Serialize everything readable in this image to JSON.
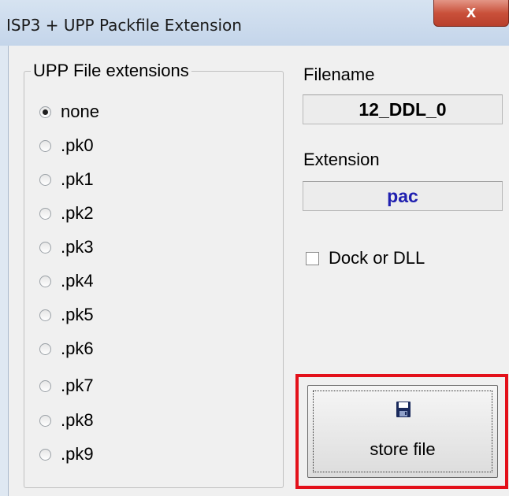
{
  "window": {
    "title": "ISP3 + UPP Packfile Extension",
    "close_label": "x"
  },
  "group": {
    "legend": "UPP File extensions",
    "options": [
      {
        "label": "none",
        "checked": true
      },
      {
        "label": ".pk0",
        "checked": false
      },
      {
        "label": ".pk1",
        "checked": false
      },
      {
        "label": ".pk2",
        "checked": false
      },
      {
        "label": ".pk3",
        "checked": false
      },
      {
        "label": ".pk4",
        "checked": false
      },
      {
        "label": ".pk5",
        "checked": false
      },
      {
        "label": ".pk6",
        "checked": false
      },
      {
        "label": ".pk7",
        "checked": false
      },
      {
        "label": ".pk8",
        "checked": false
      },
      {
        "label": ".pk9",
        "checked": false
      }
    ]
  },
  "filename": {
    "label": "Filename",
    "value": "12_DDL_0"
  },
  "extension": {
    "label": "Extension",
    "value": "pac",
    "value_color": "#2020b0"
  },
  "dock": {
    "label": "Dock or DLL",
    "checked": false
  },
  "store": {
    "label": "store file",
    "icon": "floppy-disk-icon",
    "icon_color": "#1a2a5c",
    "highlight_color": "#e3101a"
  }
}
